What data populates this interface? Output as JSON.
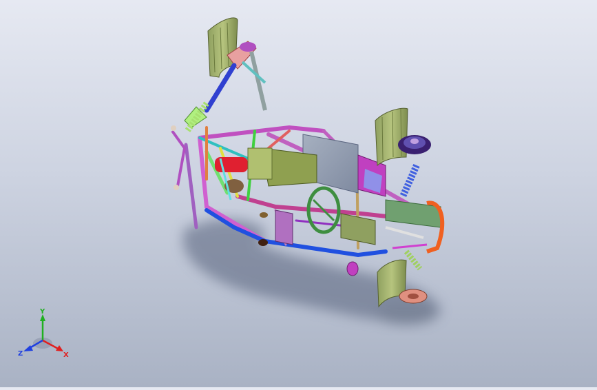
{
  "viewport": {
    "background_top": "#e6e9f2",
    "background_bottom": "#a9b2c4"
  },
  "model": {
    "icon": "kart-chassis-assembly-icon"
  },
  "triad": {
    "x_label": "X",
    "y_label": "Y",
    "z_label": "Z",
    "x_color": "#e02020",
    "y_color": "#20b020",
    "z_color": "#2040e0"
  }
}
